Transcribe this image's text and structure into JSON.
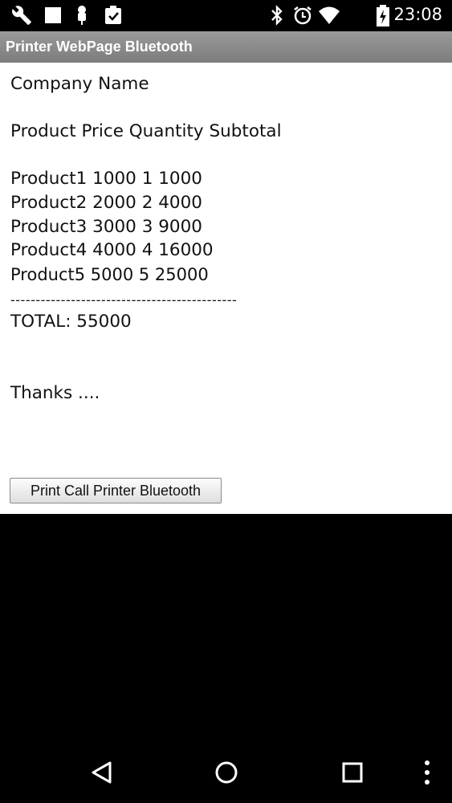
{
  "status_bar": {
    "time": "23:08",
    "left_icons": [
      "wrench-icon",
      "stop-icon",
      "android-debug-icon",
      "clipboard-check-icon"
    ],
    "right_icons": [
      "bluetooth-icon",
      "alarm-icon",
      "wifi-icon",
      "battery-charging-icon"
    ]
  },
  "app": {
    "title": "Printer WebPage Bluetooth"
  },
  "receipt": {
    "company": "Company Name",
    "header": "Product Price Quantity Subtotal",
    "items": [
      "Product1 1000 1 1000",
      "Product2 2000 2 4000",
      "Product3 3000 3 9000",
      "Product4 4000 4 16000",
      "Product5 5000 5 25000"
    ],
    "separator": "---------------------------------------------",
    "total": "TOTAL: 55000",
    "thanks": "Thanks ...."
  },
  "print_button_label": "Print Call Printer Bluetooth",
  "nav_bar": {
    "icons": [
      "back-icon",
      "home-icon",
      "recents-icon",
      "overflow-menu-icon"
    ]
  }
}
